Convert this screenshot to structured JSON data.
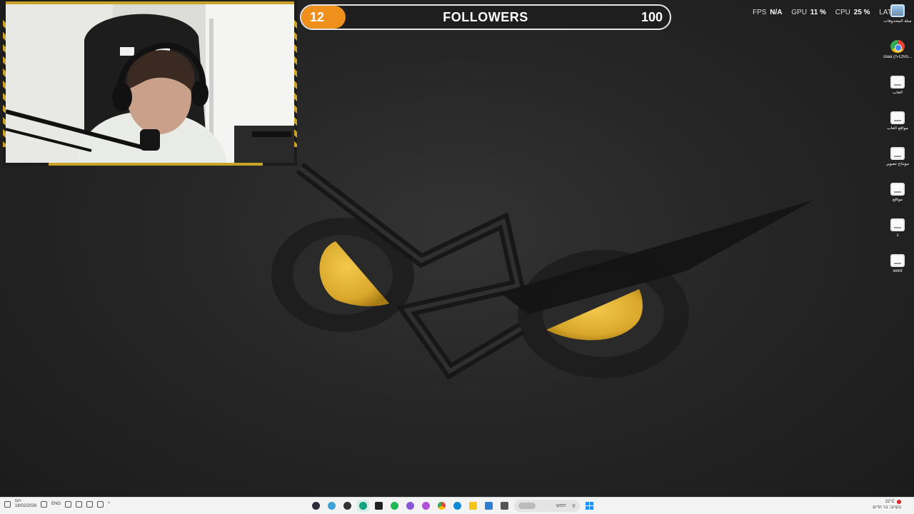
{
  "followers": {
    "current": "12",
    "title": "FOLLOWERS",
    "goal": "100",
    "progress_fraction": 0.12,
    "fill_color": "#f0901c"
  },
  "perf": {
    "fps_label": "FPS",
    "fps_value": "N/A",
    "gpu_label": "GPU",
    "gpu_value": "11 %",
    "cpu_label": "CPU",
    "cpu_value": "25 %",
    "lat_label": "LAT"
  },
  "desktop_icons": [
    {
      "label": "سلة المحذوفات",
      "icon": "recycle-bin-icon"
    },
    {
      "label": "Diaa (ה-Chro...",
      "icon": "chrome-icon"
    },
    {
      "label": "العاب",
      "icon": "folder-icon"
    },
    {
      "label": "مواقع العاب",
      "icon": "folder-icon"
    },
    {
      "label": "مونتاج تصوير",
      "icon": "folder-icon"
    },
    {
      "label": "مواقع",
      "icon": "folder-icon"
    },
    {
      "label": "1",
      "icon": "folder-icon"
    },
    {
      "label": "word",
      "icon": "folder-icon"
    }
  ],
  "taskbar": {
    "time": "ויום",
    "date": "16/02/2026",
    "language": "ENG",
    "search_placeholder": "חפש",
    "weather_temp": "22°C",
    "weather_desc": "בקרוב: בר הדים",
    "apps": [
      {
        "name": "taskbar-app-obs",
        "color": "#2b2b3a"
      },
      {
        "name": "taskbar-app-chatgpt",
        "color": "#3ba3d8"
      },
      {
        "name": "taskbar-app-copilot",
        "color": "#333333"
      },
      {
        "name": "taskbar-app-edge-green",
        "color": "#10a37f"
      },
      {
        "name": "taskbar-app-terminal",
        "color": "#222222"
      },
      {
        "name": "taskbar-app-spotify",
        "color": "#1db954"
      },
      {
        "name": "taskbar-app-teams",
        "color": "#8a56d8"
      },
      {
        "name": "taskbar-app-photos",
        "color": "#b04fd8"
      },
      {
        "name": "taskbar-app-chrome",
        "color": "#ea4335"
      },
      {
        "name": "taskbar-app-edge",
        "color": "#0c8bd9"
      },
      {
        "name": "taskbar-app-explorer",
        "color": "#f5c518"
      },
      {
        "name": "taskbar-app-store",
        "color": "#2d7dd2"
      },
      {
        "name": "taskbar-app-notepad",
        "color": "#555555"
      }
    ]
  },
  "colors": {
    "logo_gold": "#d9a72b",
    "logo_shadow": "#1a1a1a",
    "accent": "#c9a227"
  }
}
